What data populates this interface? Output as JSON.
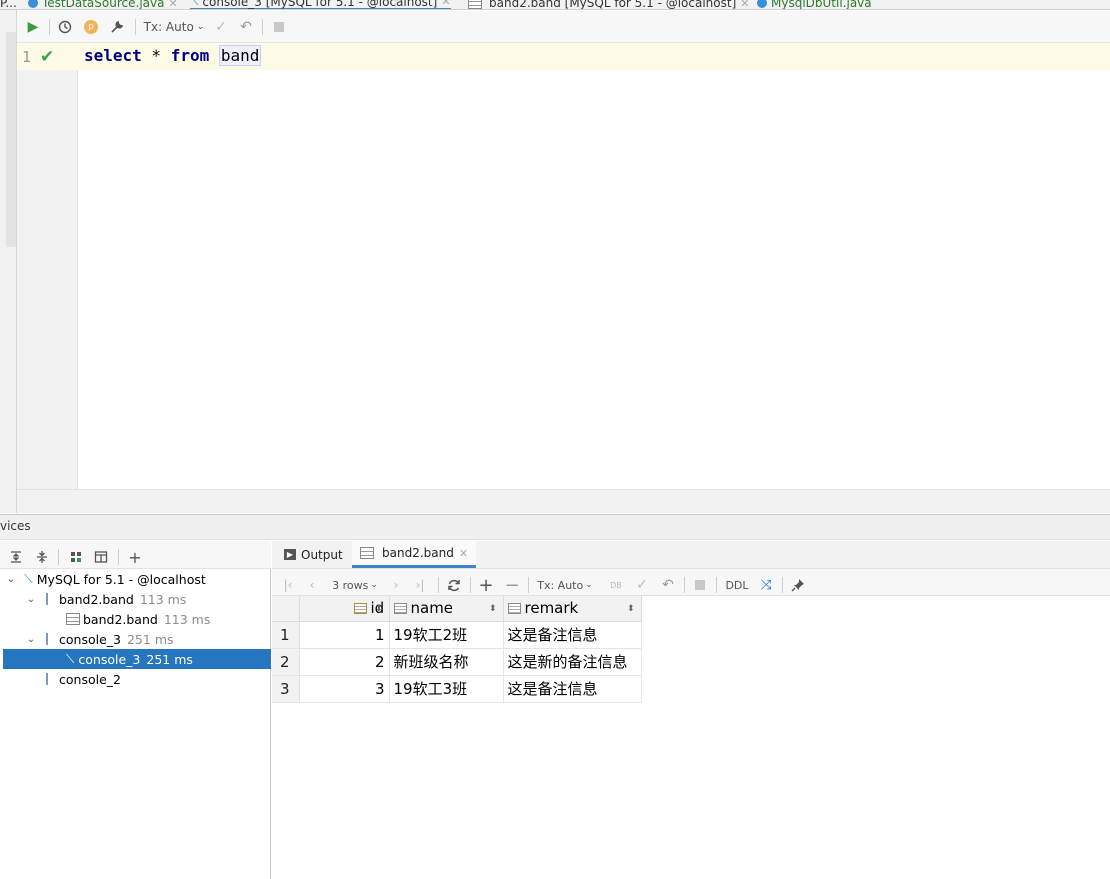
{
  "tabs": [
    {
      "label": "TestDataSource.java",
      "active": false,
      "color": "#3b8fd9"
    },
    {
      "label": "console_3 [MySQL for 5.1 - @localhost]",
      "active": true
    },
    {
      "label": "band2.band [MySQL for 5.1 - @localhost]",
      "active": false
    },
    {
      "label": "MysqlDbUtil.java",
      "active": false,
      "color": "#3b8fd9"
    }
  ],
  "editor_toolbar": {
    "tx_mode": "Tx: Auto",
    "icons": [
      "run-icon",
      "history-icon",
      "p-icon",
      "wrench-icon",
      "commit-icon",
      "rollback-icon",
      "stop-icon"
    ]
  },
  "editor": {
    "line_number": "1",
    "code": {
      "kw1": "select",
      "op": " * ",
      "kw2": "from",
      "space": " ",
      "ident": "band"
    }
  },
  "services": {
    "title": "vices",
    "tree": [
      {
        "label": "MySQL for 5.1 - @localhost",
        "time": "",
        "level": 0,
        "expanded": true
      },
      {
        "label": "band2.band",
        "time": "113 ms",
        "level": 1,
        "expanded": true
      },
      {
        "label": "band2.band",
        "time": "113 ms",
        "level": 2
      },
      {
        "label": "console_3",
        "time": "251 ms",
        "level": 1,
        "expanded": true
      },
      {
        "label": "console_3",
        "time": "251 ms",
        "level": 2,
        "selected": true
      },
      {
        "label": "console_2",
        "time": "",
        "level": 1
      }
    ]
  },
  "result_tabs": [
    {
      "label": "Output",
      "active": false
    },
    {
      "label": "band2.band",
      "active": true
    }
  ],
  "result_toolbar": {
    "rows": "3 rows",
    "tx_mode": "Tx: Auto",
    "ddl": "DDL",
    "db_label": "DB"
  },
  "grid": {
    "columns": [
      "id",
      "name",
      "remark"
    ],
    "rows": [
      {
        "n": "1",
        "id": "1",
        "name": "19软工2班",
        "remark": "这是备注信息"
      },
      {
        "n": "2",
        "id": "2",
        "name": "新班级名称",
        "remark": "这是新的备注信息"
      },
      {
        "n": "3",
        "id": "3",
        "name": "19软工3班",
        "remark": "这是备注信息"
      }
    ]
  },
  "left_strip_label": "P..."
}
